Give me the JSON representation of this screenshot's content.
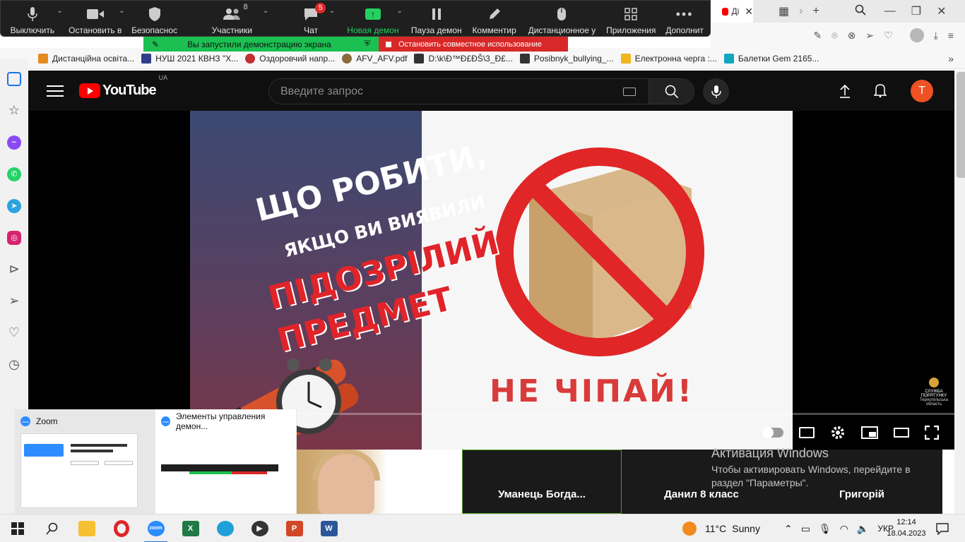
{
  "zoom_toolbar": {
    "items": [
      {
        "label": "Выключить"
      },
      {
        "label": "Остановить в"
      },
      {
        "label": "Безопаснос"
      },
      {
        "label": "Участники",
        "count": "8"
      },
      {
        "label": "Чат",
        "count": "5"
      },
      {
        "label": "Новая демон"
      },
      {
        "label": "Пауза демон"
      },
      {
        "label": "Комментир"
      },
      {
        "label": "Дистанционное у"
      },
      {
        "label": "Приложения"
      },
      {
        "label": "Дополнит"
      }
    ],
    "share_notice": "Вы запустили демонстрацию экрана",
    "stop_share": "Остановить совместное использование",
    "accent_green": "#1cc052",
    "accent_red": "#d92828"
  },
  "browser": {
    "tab_title": "Ді"
  },
  "bookmarks": [
    {
      "label": "Дистанційна освіта..."
    },
    {
      "label": "НУШ 2021 КВНЗ \"Х..."
    },
    {
      "label": "Оздоровчий напр..."
    },
    {
      "label": "AFV_AFV.pdf"
    },
    {
      "label": "D:\\k\\Ð™Ð£ÐŠ\\3_Ð£..."
    },
    {
      "label": "Posibnyk_bullying_..."
    },
    {
      "label": "Електронна черга :..."
    },
    {
      "label": "Балетки Gem 2165..."
    }
  ],
  "youtube": {
    "logo": "YouTube",
    "region": "UA",
    "search_placeholder": "Введите запрос",
    "avatar_letter": "T",
    "brand_color": "#ff0000"
  },
  "video": {
    "line1": "ЩО РОБИТИ,",
    "line2": "ЯКЩО ВИ ВИЯВИЛИ",
    "line3": "ПІДОЗРІЛИЙ",
    "line4": "ПРЕДМЕТ",
    "line5": "НЕ ЧІПАЙ!",
    "channel_mark": "СЛУЖБА ПОРЯТУНКУ",
    "channel_sub": "Тернопільська область"
  },
  "thumbnails": [
    {
      "title": "Zoom"
    },
    {
      "title": "Элементы управления демон..."
    }
  ],
  "gallery": [
    {
      "name": "Уманець  Богда..."
    },
    {
      "name": "Данил 8 класс"
    },
    {
      "name": "Григорій"
    }
  ],
  "windows_activation": {
    "title": "Активация Windows",
    "body": "Чтобы активировать Windows, перейдите в раздел \"Параметры\"."
  },
  "taskbar": {
    "weather_temp": "11°C",
    "weather_desc": "Sunny",
    "language": "УКР",
    "time": "12:14",
    "date": "18.04.2023"
  }
}
